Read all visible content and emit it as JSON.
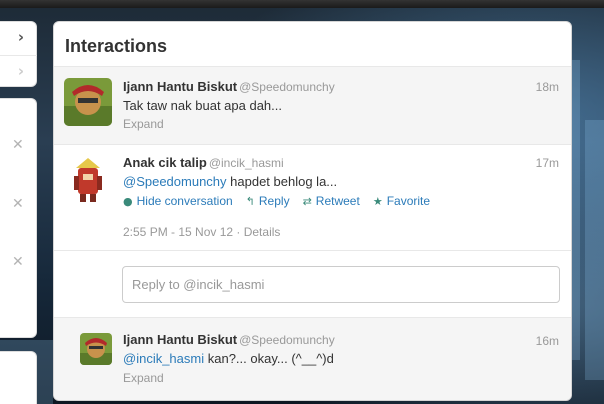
{
  "panel": {
    "title": "Interactions"
  },
  "tweets": [
    {
      "name": "Ijann Hantu Biskut",
      "handle": "@Speedomunchy",
      "time": "18m",
      "text": "Tak taw nak buat apa dah...",
      "expand": "Expand"
    },
    {
      "name": "Anak cik talip",
      "handle": "@incik_hasmi",
      "time": "17m",
      "mention": "@Speedomunchy",
      "text_rest": " hapdet behlog la...",
      "actions": {
        "hide": "Hide conversation",
        "reply": "Reply",
        "retweet": "Retweet",
        "favorite": "Favorite"
      },
      "meta": "2:55 PM - 15 Nov 12 · Details"
    },
    {
      "name": "Ijann Hantu Biskut",
      "handle": "@Speedomunchy",
      "time": "16m",
      "mention": "@incik_hasmi",
      "text_rest": " kan?... okay... (^__^)d",
      "expand": "Expand"
    }
  ],
  "reply": {
    "placeholder": "Reply to @incik_hasmi"
  },
  "icons": {
    "chevron_right": "chevron-right-icon",
    "close": "close-icon",
    "hide_conversation": "speech-bubble-icon",
    "reply": "reply-arrow-icon",
    "retweet": "retweet-icon",
    "favorite": "star-icon"
  },
  "colors": {
    "link": "#2b7bb9",
    "muted": "#999999",
    "action_icon": "#3a8a7a"
  }
}
